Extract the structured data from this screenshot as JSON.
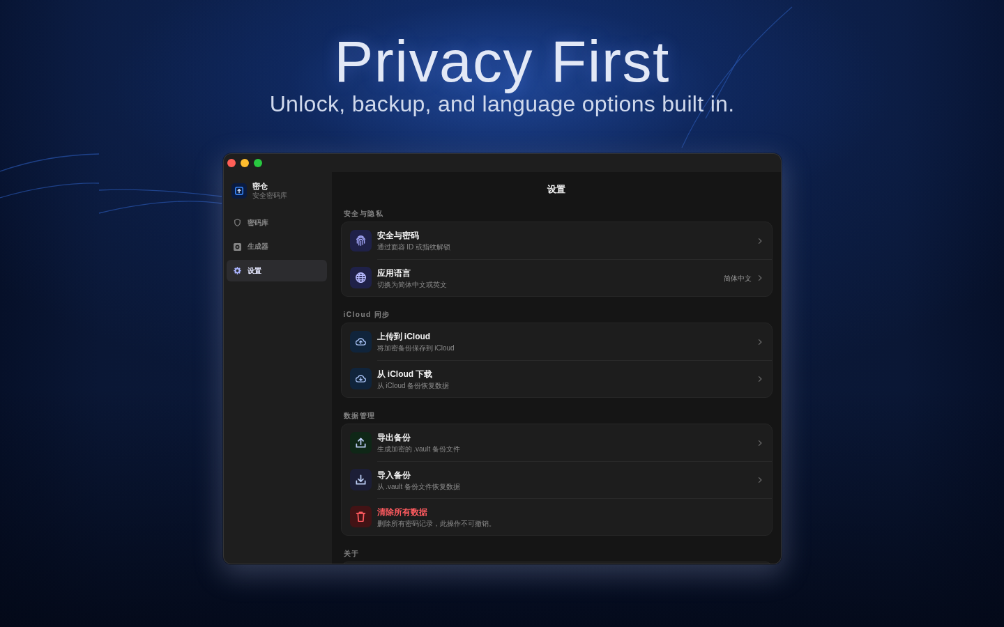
{
  "headline": {
    "title": "Privacy First",
    "subtitle": "Unlock, backup, and language options built in."
  },
  "window": {
    "app": {
      "name": "密仓",
      "tagline": "安全密码库"
    },
    "sidebar": {
      "items": [
        {
          "kind": "vault",
          "label": "密码库",
          "selected": false
        },
        {
          "kind": "generator",
          "label": "生成器",
          "selected": false
        },
        {
          "kind": "settings",
          "label": "设置",
          "selected": true
        }
      ]
    },
    "main": {
      "title": "设置",
      "sections": [
        {
          "label": "安全与隐私",
          "rows": [
            {
              "kind": "security",
              "title": "安全与密码",
              "subtitle": "通过面容 ID 或指纹解锁"
            },
            {
              "kind": "language",
              "title": "应用语言",
              "subtitle": "切换为简体中文或英文",
              "value": "简体中文"
            }
          ]
        },
        {
          "label": "iCloud 同步",
          "rows": [
            {
              "kind": "upload",
              "title": "上传到 iCloud",
              "subtitle": "将加密备份保存到 iCloud"
            },
            {
              "kind": "download",
              "title": "从 iCloud 下载",
              "subtitle": "从 iCloud 备份恢复数据"
            }
          ]
        },
        {
          "label": "数据管理",
          "rows": [
            {
              "kind": "export",
              "title": "导出备份",
              "subtitle": "生成加密的 .vault 备份文件"
            },
            {
              "kind": "import",
              "title": "导入备份",
              "subtitle": "从 .vault 备份文件恢复数据"
            },
            {
              "kind": "erase",
              "title": "清除所有数据",
              "subtitle": "删除所有密码记录，此操作不可撤销。"
            }
          ]
        },
        {
          "label": "关于"
        }
      ]
    }
  }
}
